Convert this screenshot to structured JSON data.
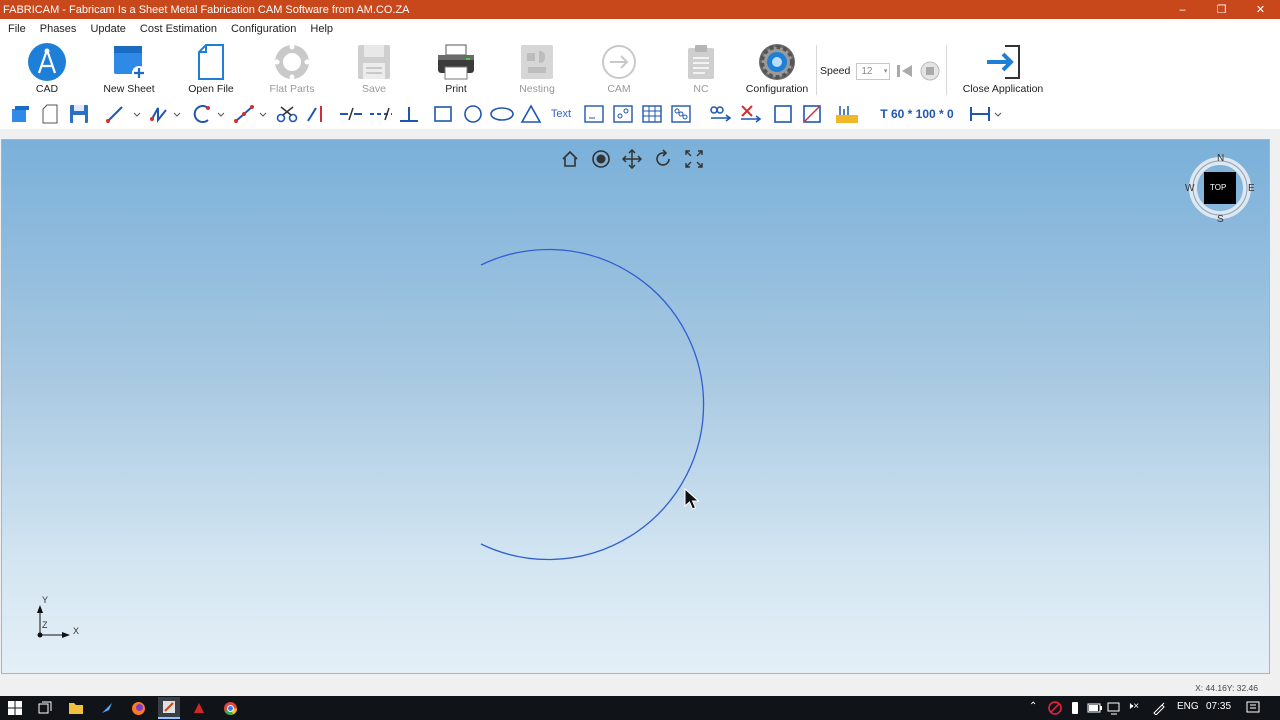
{
  "window": {
    "title": "FABRICAM - Fabricam Is a Sheet Metal Fabrication CAM Software from AM.CO.ZA",
    "controls": [
      "–",
      "❐",
      "✕"
    ]
  },
  "menu": [
    "File",
    "Phases",
    "Update",
    "Cost Estimation",
    "Configuration",
    "Help"
  ],
  "ribbon": {
    "cad": "CAD",
    "new_sheet": "New Sheet",
    "open_file": "Open File",
    "flat_parts": "Flat Parts",
    "save": "Save",
    "print": "Print",
    "nesting": "Nesting",
    "cam": "CAM",
    "nc": "NC",
    "configuration": "Configuration",
    "speed_label": "Speed",
    "speed_value": "12",
    "close_application": "Close Application"
  },
  "toolbar2": {
    "text_tool": "Text",
    "dimensions": "T 60 * 100 * 0"
  },
  "viewport": {
    "compass": {
      "n": "N",
      "s": "S",
      "e": "E",
      "w": "W",
      "view": "TOP"
    },
    "axes": {
      "y": "Y",
      "x": "X",
      "z": "Z"
    }
  },
  "status": {
    "coords": "X: 44.16Y: 32.46"
  },
  "taskbar": {
    "lang": "ENG",
    "time": "07:35"
  },
  "colors": {
    "titlebar": "#c8481b",
    "accent": "#1e7fd8",
    "arc": "#2f5fd0"
  }
}
